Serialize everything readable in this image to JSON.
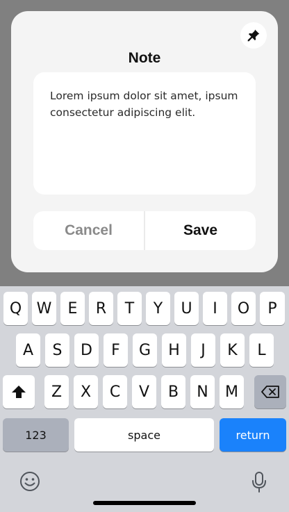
{
  "note_dialog": {
    "title": "Note",
    "text": "Lorem ipsum dolor sit amet, ipsum consectetur adipiscing elit.",
    "cancel_label": "Cancel",
    "save_label": "Save",
    "pin_icon": "pin-icon"
  },
  "keyboard": {
    "row1": [
      "Q",
      "W",
      "E",
      "R",
      "T",
      "Y",
      "U",
      "I",
      "O",
      "P"
    ],
    "row2": [
      "A",
      "S",
      "D",
      "F",
      "G",
      "H",
      "J",
      "K",
      "L"
    ],
    "row3": [
      "Z",
      "X",
      "C",
      "V",
      "B",
      "N",
      "M"
    ],
    "numbers_label": "123",
    "space_label": "space",
    "return_label": "return",
    "shift_icon": "shift-icon",
    "backspace_icon": "backspace-icon",
    "emoji_icon": "emoji-icon",
    "mic_icon": "microphone-icon"
  },
  "colors": {
    "backdrop": "#808080",
    "card": "#f4f4f4",
    "keyboard": "#d3d5da",
    "return_key": "#1a82fb"
  }
}
